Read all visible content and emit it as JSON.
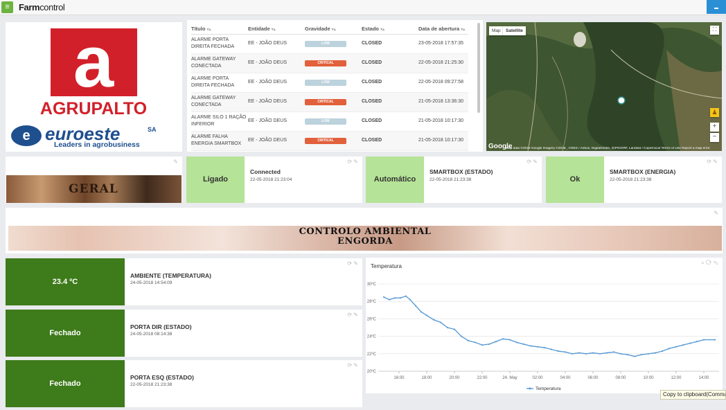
{
  "app": {
    "brand_bold": "Farm",
    "brand_rest": "control"
  },
  "logo": {
    "letter": "a",
    "company": "AGRUPALTO",
    "partner": "euroeste",
    "partner_suffix": "SA",
    "tagline": "Leaders in agrobusiness"
  },
  "alarms": {
    "headers": [
      "Título",
      "Entidade",
      "Gravidade",
      "Estado",
      "Data de abertura"
    ],
    "rows": [
      {
        "title": "ALARME PORTA DIREITA FECHADA",
        "entity": "EE - JOÃO DEUS",
        "severity": "LOW",
        "state": "CLOSED",
        "date": "23-05-2018 17:57:35"
      },
      {
        "title": "ALARME GATEWAY CONECTADA",
        "entity": "EE - JOÃO DEUS",
        "severity": "CRITICAL",
        "state": "CLOSED",
        "date": "22-05-2018 21:25:30"
      },
      {
        "title": "ALARME PORTA DIREITA FECHADA",
        "entity": "EE - JOÃO DEUS",
        "severity": "LOW",
        "state": "CLOSED",
        "date": "22-05-2018 09:27:58"
      },
      {
        "title": "ALARME GATEWAY CONECTADA",
        "entity": "EE - JOÃO DEUS",
        "severity": "CRITICAL",
        "state": "CLOSED",
        "date": "21-05-2018 13:36:30"
      },
      {
        "title": "ALARME SILO 1 RAÇÃO INFERIOR",
        "entity": "EE - JOÃO DEUS",
        "severity": "LOW",
        "state": "CLOSED",
        "date": "21-05-2018 10:17:30"
      },
      {
        "title": "ALARME FALHA ENERGIA SMARTBOX",
        "entity": "EE - JOÃO DEUS",
        "severity": "CRITICAL",
        "state": "CLOSED",
        "date": "21-05-2018 10:17:30"
      }
    ]
  },
  "map": {
    "tab_map": "Map",
    "tab_satellite": "Satellite",
    "google": "Google",
    "footer": "Map data ©2018 Google Imagery ©2018 , CNES / Airbus, DigitalGlobe, IGP/DGRF, Landsat / Copernicus    Terms of Use    Report a map error",
    "zoom_in": "+",
    "zoom_out": "−"
  },
  "geral": {
    "label": "GERAL"
  },
  "status_cards": [
    {
      "value": "Ligado",
      "title": "Connected",
      "time": "22-05-2018 21:23:04"
    },
    {
      "value": "Automático",
      "title": "SMARTBOX (ESTADO)",
      "time": "22-05-2018 21:23:38"
    },
    {
      "value": "Ok",
      "title": "SMARTBOX (ENERGIA)",
      "time": "22-05-2018 21:23:38"
    }
  ],
  "banner": {
    "line1": "CONTROLO AMBIENTAL",
    "line2": "ENGORDA"
  },
  "readings": [
    {
      "value": "23.4 ºC",
      "title": "AMBIENTE (TEMPERATURA)",
      "time": "24-05-2018 14:54:09"
    },
    {
      "value": "Fechado",
      "title": "PORTA DIR (ESTADO)",
      "time": "24-05-2018 08:14:38"
    },
    {
      "value": "Fechado",
      "title": "PORTA ESQ (ESTADO)",
      "time": "22-05-2018 21:23:38"
    }
  ],
  "chart_data": {
    "type": "line",
    "title": "Temperatura",
    "x_ticks": [
      "16:00",
      "18:00",
      "20:00",
      "22:00",
      "24. May",
      "02:00",
      "04:00",
      "06:00",
      "08:00",
      "10:00",
      "12:00",
      "14:00"
    ],
    "ylim": [
      20,
      30
    ],
    "y_ticks": [
      "20ºC",
      "22ºC",
      "24ºC",
      "26ºC",
      "28ºC",
      "30ºC"
    ],
    "legend": "Temperatura",
    "color": "#5b9bd5",
    "x_hours": [
      14.9,
      15.3,
      15.7,
      16.1,
      16.5,
      16.8,
      17.2,
      17.6,
      18.0,
      18.5,
      19.0,
      19.5,
      20.0,
      20.5,
      21.0,
      21.5,
      22.0,
      22.5,
      23.0,
      23.5,
      24.0,
      24.5,
      25.0,
      25.5,
      26.0,
      26.5,
      27.0,
      27.5,
      28.0,
      28.5,
      29.0,
      29.5,
      30.0,
      30.5,
      31.0,
      31.5,
      32.0,
      32.5,
      33.0,
      33.5,
      34.0,
      34.5,
      35.0,
      35.5,
      36.0,
      36.5,
      37.0,
      37.5,
      38.0,
      38.8
    ],
    "values": [
      28.5,
      28.2,
      28.4,
      28.4,
      28.6,
      28.2,
      27.5,
      26.8,
      26.4,
      25.9,
      25.6,
      25.0,
      24.8,
      24.0,
      23.5,
      23.3,
      23.0,
      23.1,
      23.4,
      23.7,
      23.6,
      23.3,
      23.1,
      22.9,
      22.8,
      22.7,
      22.5,
      22.3,
      22.2,
      22.0,
      22.1,
      22.0,
      22.1,
      22.0,
      22.1,
      22.2,
      22.0,
      21.9,
      21.7,
      21.9,
      22.0,
      22.1,
      22.3,
      22.6,
      22.8,
      23.0,
      23.2,
      23.4,
      23.6,
      23.6
    ]
  },
  "clipboard": "Copy to clipboard(Command+C)"
}
